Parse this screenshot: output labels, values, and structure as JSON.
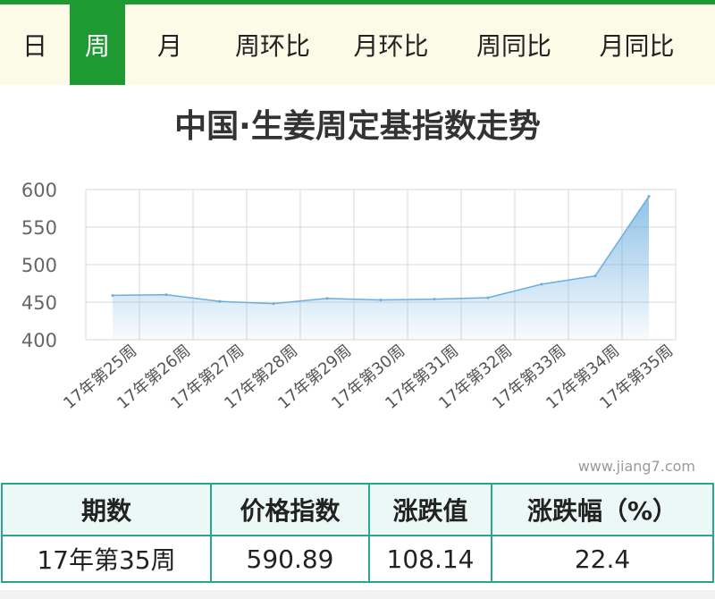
{
  "tabs": [
    {
      "label": "日",
      "active": false
    },
    {
      "label": "周",
      "active": true
    },
    {
      "label": "月",
      "active": false
    },
    {
      "label": "周环比",
      "active": false
    },
    {
      "label": "月环比",
      "active": false
    },
    {
      "label": "周同比",
      "active": false
    },
    {
      "label": "月同比",
      "active": false
    }
  ],
  "watermark": "www.jiang7.com",
  "colors": {
    "accent": "#1f9a32",
    "line": "#6aaee0",
    "table_border": "#2aa58f"
  },
  "chart_data": {
    "type": "area",
    "title": "中国·生姜周定基指数走势",
    "xlabel": "",
    "ylabel": "",
    "categories": [
      "17年第25周",
      "17年第26周",
      "17年第27周",
      "17年第28周",
      "17年第29周",
      "17年第30周",
      "17年第31周",
      "17年第32周",
      "17年第33周",
      "17年第34周",
      "17年第35周"
    ],
    "values": [
      459,
      460,
      451,
      448,
      455,
      453,
      454,
      456,
      474,
      485,
      590.89
    ],
    "ylim": [
      400,
      600
    ],
    "yticks": [
      400,
      450,
      500,
      550,
      600
    ],
    "grid": true,
    "legend": "none"
  },
  "table": {
    "headers": [
      "期数",
      "价格指数",
      "涨跌值",
      "涨跌幅（%）"
    ],
    "row": [
      "17年第35周",
      "590.89",
      "108.14",
      "22.4"
    ]
  }
}
